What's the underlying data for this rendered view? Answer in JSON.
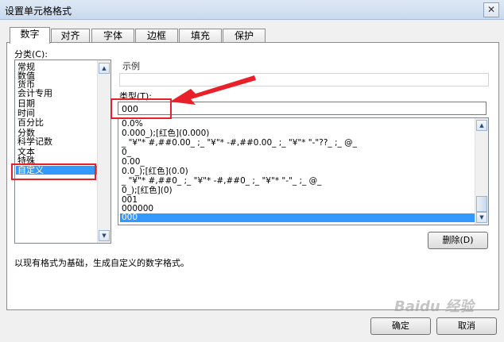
{
  "window": {
    "title": "设置单元格格式",
    "close": "✕"
  },
  "tabs": [
    "数字",
    "对齐",
    "字体",
    "边框",
    "填充",
    "保护"
  ],
  "category": {
    "label": "分类(C):",
    "items": [
      "常规",
      "数值",
      "货币",
      "会计专用",
      "日期",
      "时间",
      "百分比",
      "分数",
      "科学记数",
      "文本",
      "特殊",
      "自定义"
    ],
    "selected": "自定义"
  },
  "example": {
    "label": "示例"
  },
  "type": {
    "label": "类型(T):",
    "value": "000",
    "formats": [
      "0.0%",
      "0.000_);[红色](0.000)",
      "_ \"¥\"* #,##0.00_ ;_ \"¥\"* -#,##0.00_ ;_ \"¥\"* \"-\"??_ ;_ @_",
      "0_",
      "0.00_",
      "0.0_);[红色](0.0)",
      "_ \"¥\"* #,##0_ ;_ \"¥\"* -#,##0_ ;_ \"¥\"* \"-\"_ ;_ @_",
      "0_);[红色](0)",
      "001",
      "000000",
      "000"
    ],
    "selected": "000"
  },
  "delete_button": "删除(D)",
  "hint": "以现有格式为基础，生成自定义的数字格式。",
  "ok_button": "确定",
  "cancel_button": "取消",
  "watermark": "Baidu 经验"
}
